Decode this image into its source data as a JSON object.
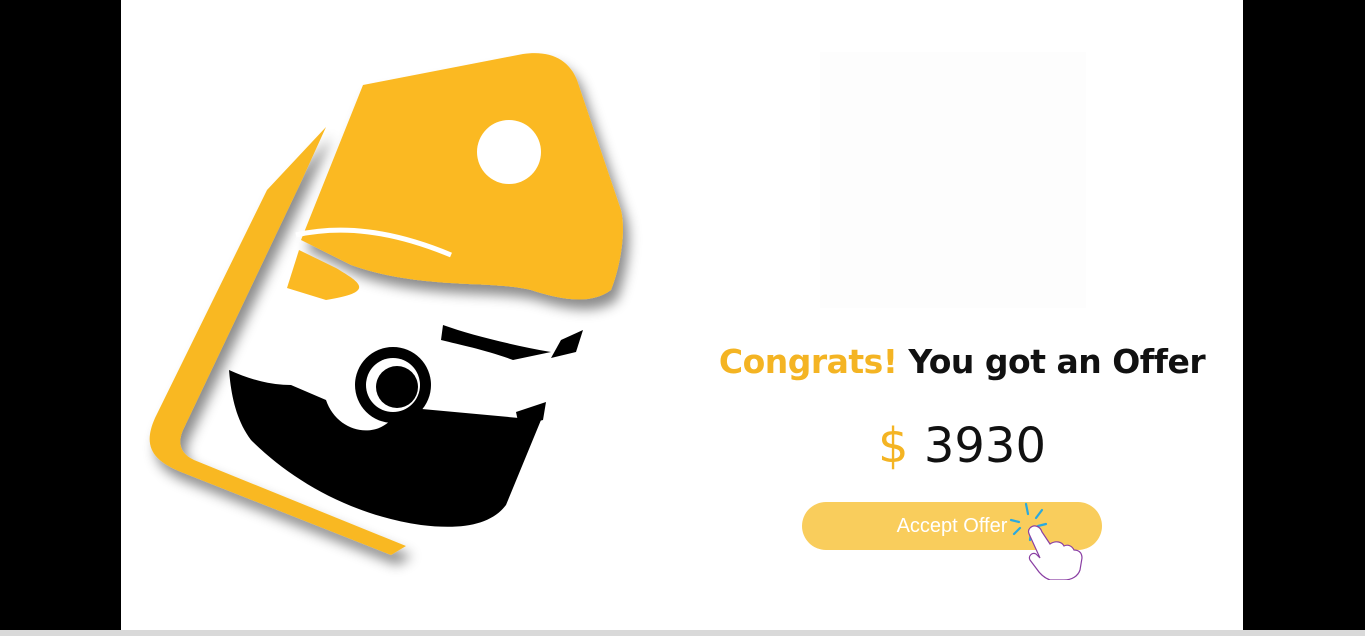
{
  "offer": {
    "congrats": "Congrats!",
    "message": "You got an Offer",
    "currency": "$",
    "amount": "3930",
    "button_label": "Accept Offer"
  },
  "icons": {
    "logo": "car-price-tag-logo",
    "pointer": "hand-pointer-icon"
  },
  "colors": {
    "accent": "#f4b423",
    "button": "#f9cd5c",
    "text": "#111111",
    "background": "#ffffff",
    "frame": "#000000"
  }
}
